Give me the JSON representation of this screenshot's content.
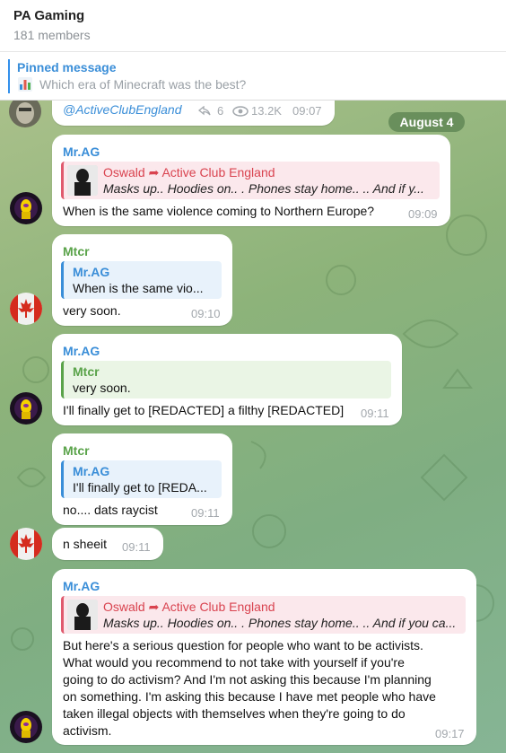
{
  "header": {
    "title": "PA Gaming",
    "members": "181 members"
  },
  "pinned": {
    "label": "Pinned message",
    "text": "Which era of Minecraft was the best?"
  },
  "top_message": {
    "text": "@ActiveClubEngland",
    "shares": "6",
    "views": "13.2K",
    "time": "09:07"
  },
  "date_pill": "August 4",
  "messages": [
    {
      "sender": "Mr.AG",
      "forward_from": "Oswald",
      "forward_channel": "Active Club England",
      "forward_text": "Masks up.. Hoodies on.. . Phones stay home.. .. And if y...",
      "text": "When is the same violence coming to Northern Europe?",
      "time": "09:09"
    },
    {
      "sender": "Mtcr",
      "reply_name": "Mr.AG",
      "reply_text": "When is the same vio...",
      "text": "very soon.",
      "time": "09:10"
    },
    {
      "sender": "Mr.AG",
      "reply_name": "Mtcr",
      "reply_text": "very soon.",
      "text": "I'll finally get to [REDACTED] a filthy [REDACTED]",
      "time": "09:11"
    },
    {
      "sender": "Mtcr",
      "reply_name": "Mr.AG",
      "reply_text": "I'll finally get to [REDA...",
      "text": "no.... dats raycist",
      "time": "09:11"
    },
    {
      "text": "n sheeit",
      "time": "09:11"
    },
    {
      "sender": "Mr.AG",
      "forward_from": "Oswald",
      "forward_channel": "Active Club England",
      "forward_text": "Masks up.. Hoodies on.. . Phones stay home.. .. And if you ca...",
      "lines": [
        "But here's a serious question for people who want to be activists.",
        "What would you recommend to not take with yourself if you're",
        "going to do activism?  And I'm not asking this because I'm planning",
        "on something. I'm asking this because I have met people who have",
        "taken illegal objects with themselves when they're going to do",
        "activism."
      ],
      "time": "09:17"
    }
  ],
  "colors": {
    "accent_blue": "#3a8ed8",
    "mtcr_green": "#5aa34a",
    "forward_red": "#d9434f"
  }
}
